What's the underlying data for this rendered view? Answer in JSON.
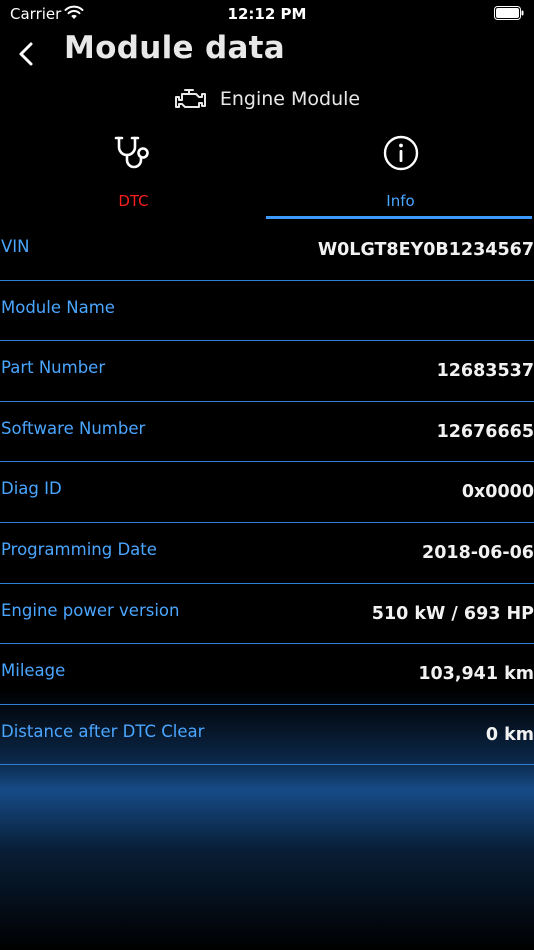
{
  "status_bar": {
    "carrier": "Carrier",
    "time": "12:12 PM"
  },
  "nav": {
    "title": "Module data"
  },
  "module": {
    "name": "Engine Module",
    "icon": "engine-icon"
  },
  "tabs": [
    {
      "label": "DTC",
      "icon": "stethoscope-icon",
      "active": false,
      "color": "#ff1e1e"
    },
    {
      "label": "Info",
      "icon": "info-icon",
      "active": true,
      "color": "#4aa6ff"
    }
  ],
  "rows": [
    {
      "label": "VIN",
      "value": "W0LGT8EY0B1234567"
    },
    {
      "label": "Module Name",
      "value": ""
    },
    {
      "label": "Part Number",
      "value": "12683537"
    },
    {
      "label": "Software Number",
      "value": "12676665"
    },
    {
      "label": "Diag ID",
      "value": "0x0000"
    },
    {
      "label": "Programming Date",
      "value": "2018-06-06"
    },
    {
      "label": "Engine power version",
      "value": "510 kW / 693 HP"
    },
    {
      "label": "Mileage",
      "value": "103,941 km"
    },
    {
      "label": "Distance after DTC Clear",
      "value": "0 km"
    }
  ],
  "colors": {
    "accent": "#3d9bff",
    "label": "#4aa6ff",
    "alert": "#ff1e1e",
    "background": "#000000"
  }
}
